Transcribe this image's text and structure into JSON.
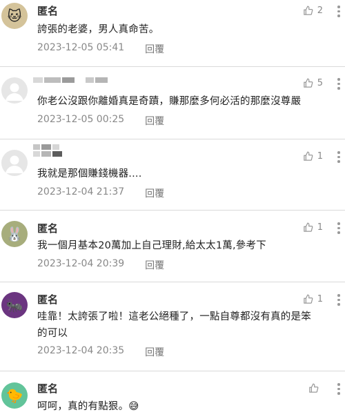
{
  "colors": {
    "meta": "#888888",
    "divider": "#d9d9d9",
    "text": "#222222"
  },
  "reply_label": "回覆",
  "comments": [
    {
      "avatar_icon": "cat-icon",
      "avatar_color": "#d4c39a",
      "avatar_glyph": "🐱",
      "anonymous": true,
      "name": "匿名",
      "likes": "2",
      "text": "誇張的老婆，男人真命苦。",
      "time": "2023-12-05 05:41"
    },
    {
      "avatar_icon": "default-user-icon",
      "avatar_color": "#e6e6e6",
      "avatar_glyph": "",
      "anonymous": false,
      "name": "",
      "likes": "5",
      "text": "你老公沒跟你離婚真是奇蹟，賺那麼多何必活的那麼沒尊嚴",
      "time": "2023-12-05 00:25"
    },
    {
      "avatar_icon": "default-user-icon",
      "avatar_color": "#e6e6e6",
      "avatar_glyph": "",
      "anonymous": false,
      "name": "",
      "likes": "1",
      "text": "我就是那個賺錢機器....",
      "time": "2023-12-04 21:37"
    },
    {
      "avatar_icon": "rabbit-icon",
      "avatar_color": "#a7ad7c",
      "avatar_glyph": "🐰",
      "anonymous": true,
      "name": "匿名",
      "likes": "1",
      "text": "我一個月基本20萬加上自己理財,給太太1萬,參考下",
      "time": "2023-12-04 20:39"
    },
    {
      "avatar_icon": "ant-icon",
      "avatar_color": "#6b3580",
      "avatar_glyph": "🐜",
      "anonymous": true,
      "name": "匿名",
      "likes": "1",
      "text_lines": [
        "哇靠！太誇張了啦！這老公絕種了，一點自尊都沒有真的是笨",
        "的可以"
      ],
      "time": "2023-12-04 20:35"
    },
    {
      "avatar_icon": "chick-icon",
      "avatar_color": "#62c49a",
      "avatar_glyph": "🐤",
      "anonymous": true,
      "name": "匿名",
      "likes": "",
      "text": "呵呵，真的有點狠。😅",
      "time": ""
    }
  ]
}
